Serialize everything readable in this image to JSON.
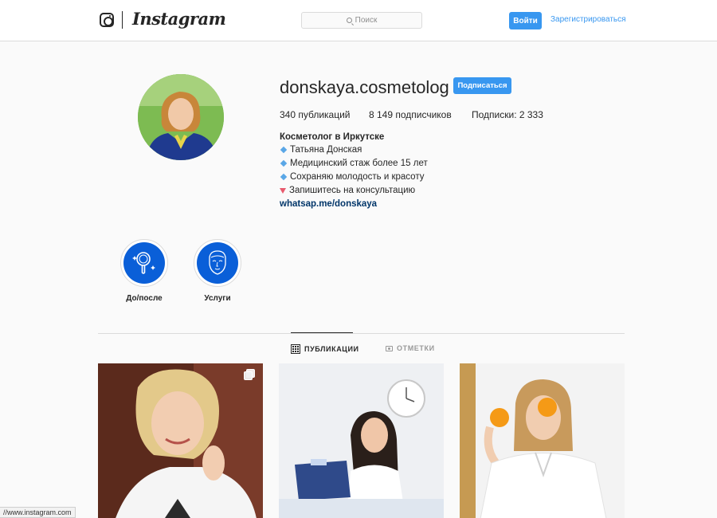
{
  "header": {
    "brand": "Instagram",
    "search_placeholder": "Поиск",
    "login_label": "Войти",
    "signup_label": "Зарегистрироваться"
  },
  "profile": {
    "username": "donskaya.cosmetolog",
    "follow_label": "Подписаться",
    "stats": {
      "posts": "340 публикаций",
      "followers": "8 149 подписчиков",
      "following": "Подписки: 2 333"
    },
    "bio": {
      "name": "Косметолог в Иркутске",
      "lines": [
        "Татьяна Донская",
        "Медицинский стаж более 15 лет",
        "Сохраняю молодость и красоту",
        "Запишитесь на консультацию"
      ],
      "link": "whatsap.me/donskaya"
    }
  },
  "highlights": [
    {
      "label": "До/после",
      "icon": "hand-mirror-icon"
    },
    {
      "label": "Услуги",
      "icon": "face-mask-icon"
    }
  ],
  "tabs": [
    {
      "label": "ПУБЛИКАЦИИ",
      "icon": "grid-icon",
      "active": true
    },
    {
      "label": "ОТМЕТКИ",
      "icon": "tag-icon",
      "active": false
    }
  ],
  "posts": [
    {
      "subject": "portrait-blonde-woman",
      "multi": true
    },
    {
      "subject": "woman-at-desk-on-phone",
      "multi": false
    },
    {
      "subject": "woman-with-oranges",
      "multi": false
    }
  ],
  "status_bar": {
    "url": "//www.instagram.com"
  },
  "colors": {
    "accent": "#3897f0",
    "highlight_fill": "#0a5fd8",
    "link": "#003569",
    "background": "#fafafa"
  }
}
